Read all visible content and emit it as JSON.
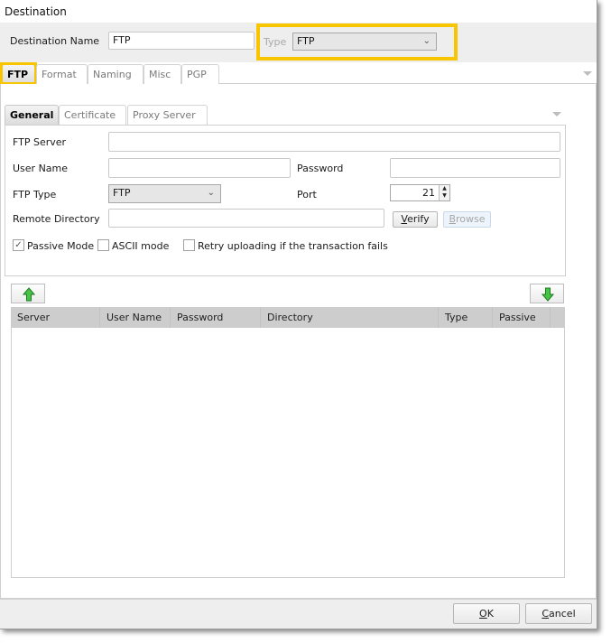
{
  "window": {
    "title": "Destination"
  },
  "header": {
    "destination_name_label": "Destination Name",
    "destination_name_value": "FTP",
    "type_label": "Type",
    "type_value": "FTP"
  },
  "colors": {
    "highlight": "#f7c600",
    "accent_arrow": "#3cb43c"
  },
  "main_tabs": [
    {
      "label": "FTP",
      "active": true
    },
    {
      "label": "Format",
      "active": false
    },
    {
      "label": "Naming",
      "active": false
    },
    {
      "label": "Misc",
      "active": false
    },
    {
      "label": "PGP",
      "active": false
    }
  ],
  "sub_tabs": [
    {
      "label": "General",
      "active": true
    },
    {
      "label": "Certificate",
      "active": false
    },
    {
      "label": "Proxy Server",
      "active": false
    }
  ],
  "form": {
    "ftp_server_label": "FTP Server",
    "ftp_server_value": "",
    "user_name_label": "User Name",
    "user_name_value": "",
    "password_label": "Password",
    "password_value": "",
    "ftp_type_label": "FTP Type",
    "ftp_type_value": "FTP",
    "port_label": "Port",
    "port_value": "21",
    "remote_directory_label": "Remote Directory",
    "remote_directory_value": "",
    "verify_label": "Verify",
    "verify_mnemonic": "V",
    "verify_rest": "erify",
    "browse_mnemonic": "B",
    "browse_rest": "rowse",
    "passive_mode_label": "Passive Mode",
    "passive_mode_checked": true,
    "ascii_mode_label": "ASCII mode",
    "ascii_mode_checked": false,
    "retry_label": "Retry uploading if the transaction fails",
    "retry_checked": false
  },
  "grid": {
    "columns": [
      "Server",
      "User Name",
      "Password",
      "Directory",
      "Type",
      "Passive"
    ],
    "rows": []
  },
  "icons": {
    "move_up": "arrow-up-green",
    "move_down": "arrow-down-green",
    "check": "✓",
    "chevron": "﹀"
  },
  "footer": {
    "ok_mnemonic": "O",
    "ok_rest": "K",
    "cancel_mnemonic": "C",
    "cancel_rest": "ancel"
  }
}
